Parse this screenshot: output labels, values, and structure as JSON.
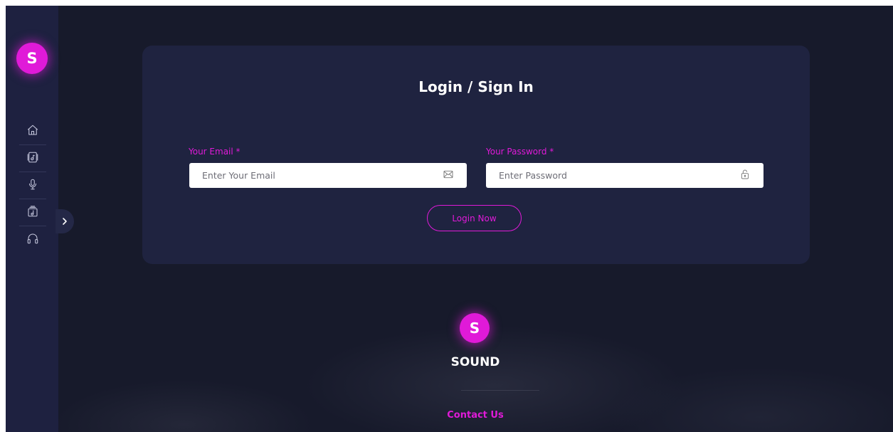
{
  "brand": {
    "logo_letter": "S",
    "name": "SOUND"
  },
  "sidebar": {
    "items": [
      {
        "icon": "home-icon"
      },
      {
        "icon": "music-library-icon"
      },
      {
        "icon": "microphone-icon"
      },
      {
        "icon": "album-icon"
      },
      {
        "icon": "headphones-icon"
      }
    ],
    "toggle_icon": "chevron-right-icon"
  },
  "login": {
    "title": "Login / Sign In",
    "email_label": "Your Email *",
    "email_placeholder": "Enter Your Email",
    "email_icon": "envelope-icon",
    "password_label": "Your Password *",
    "password_placeholder": "Enter Password",
    "password_icon": "lock-icon",
    "submit_label": "Login Now"
  },
  "footer": {
    "contact_label": "Contact Us"
  },
  "colors": {
    "accent": "#e01ad8",
    "background": "#171a2b",
    "sidebar": "#1e2140",
    "card": "#1f2340"
  }
}
